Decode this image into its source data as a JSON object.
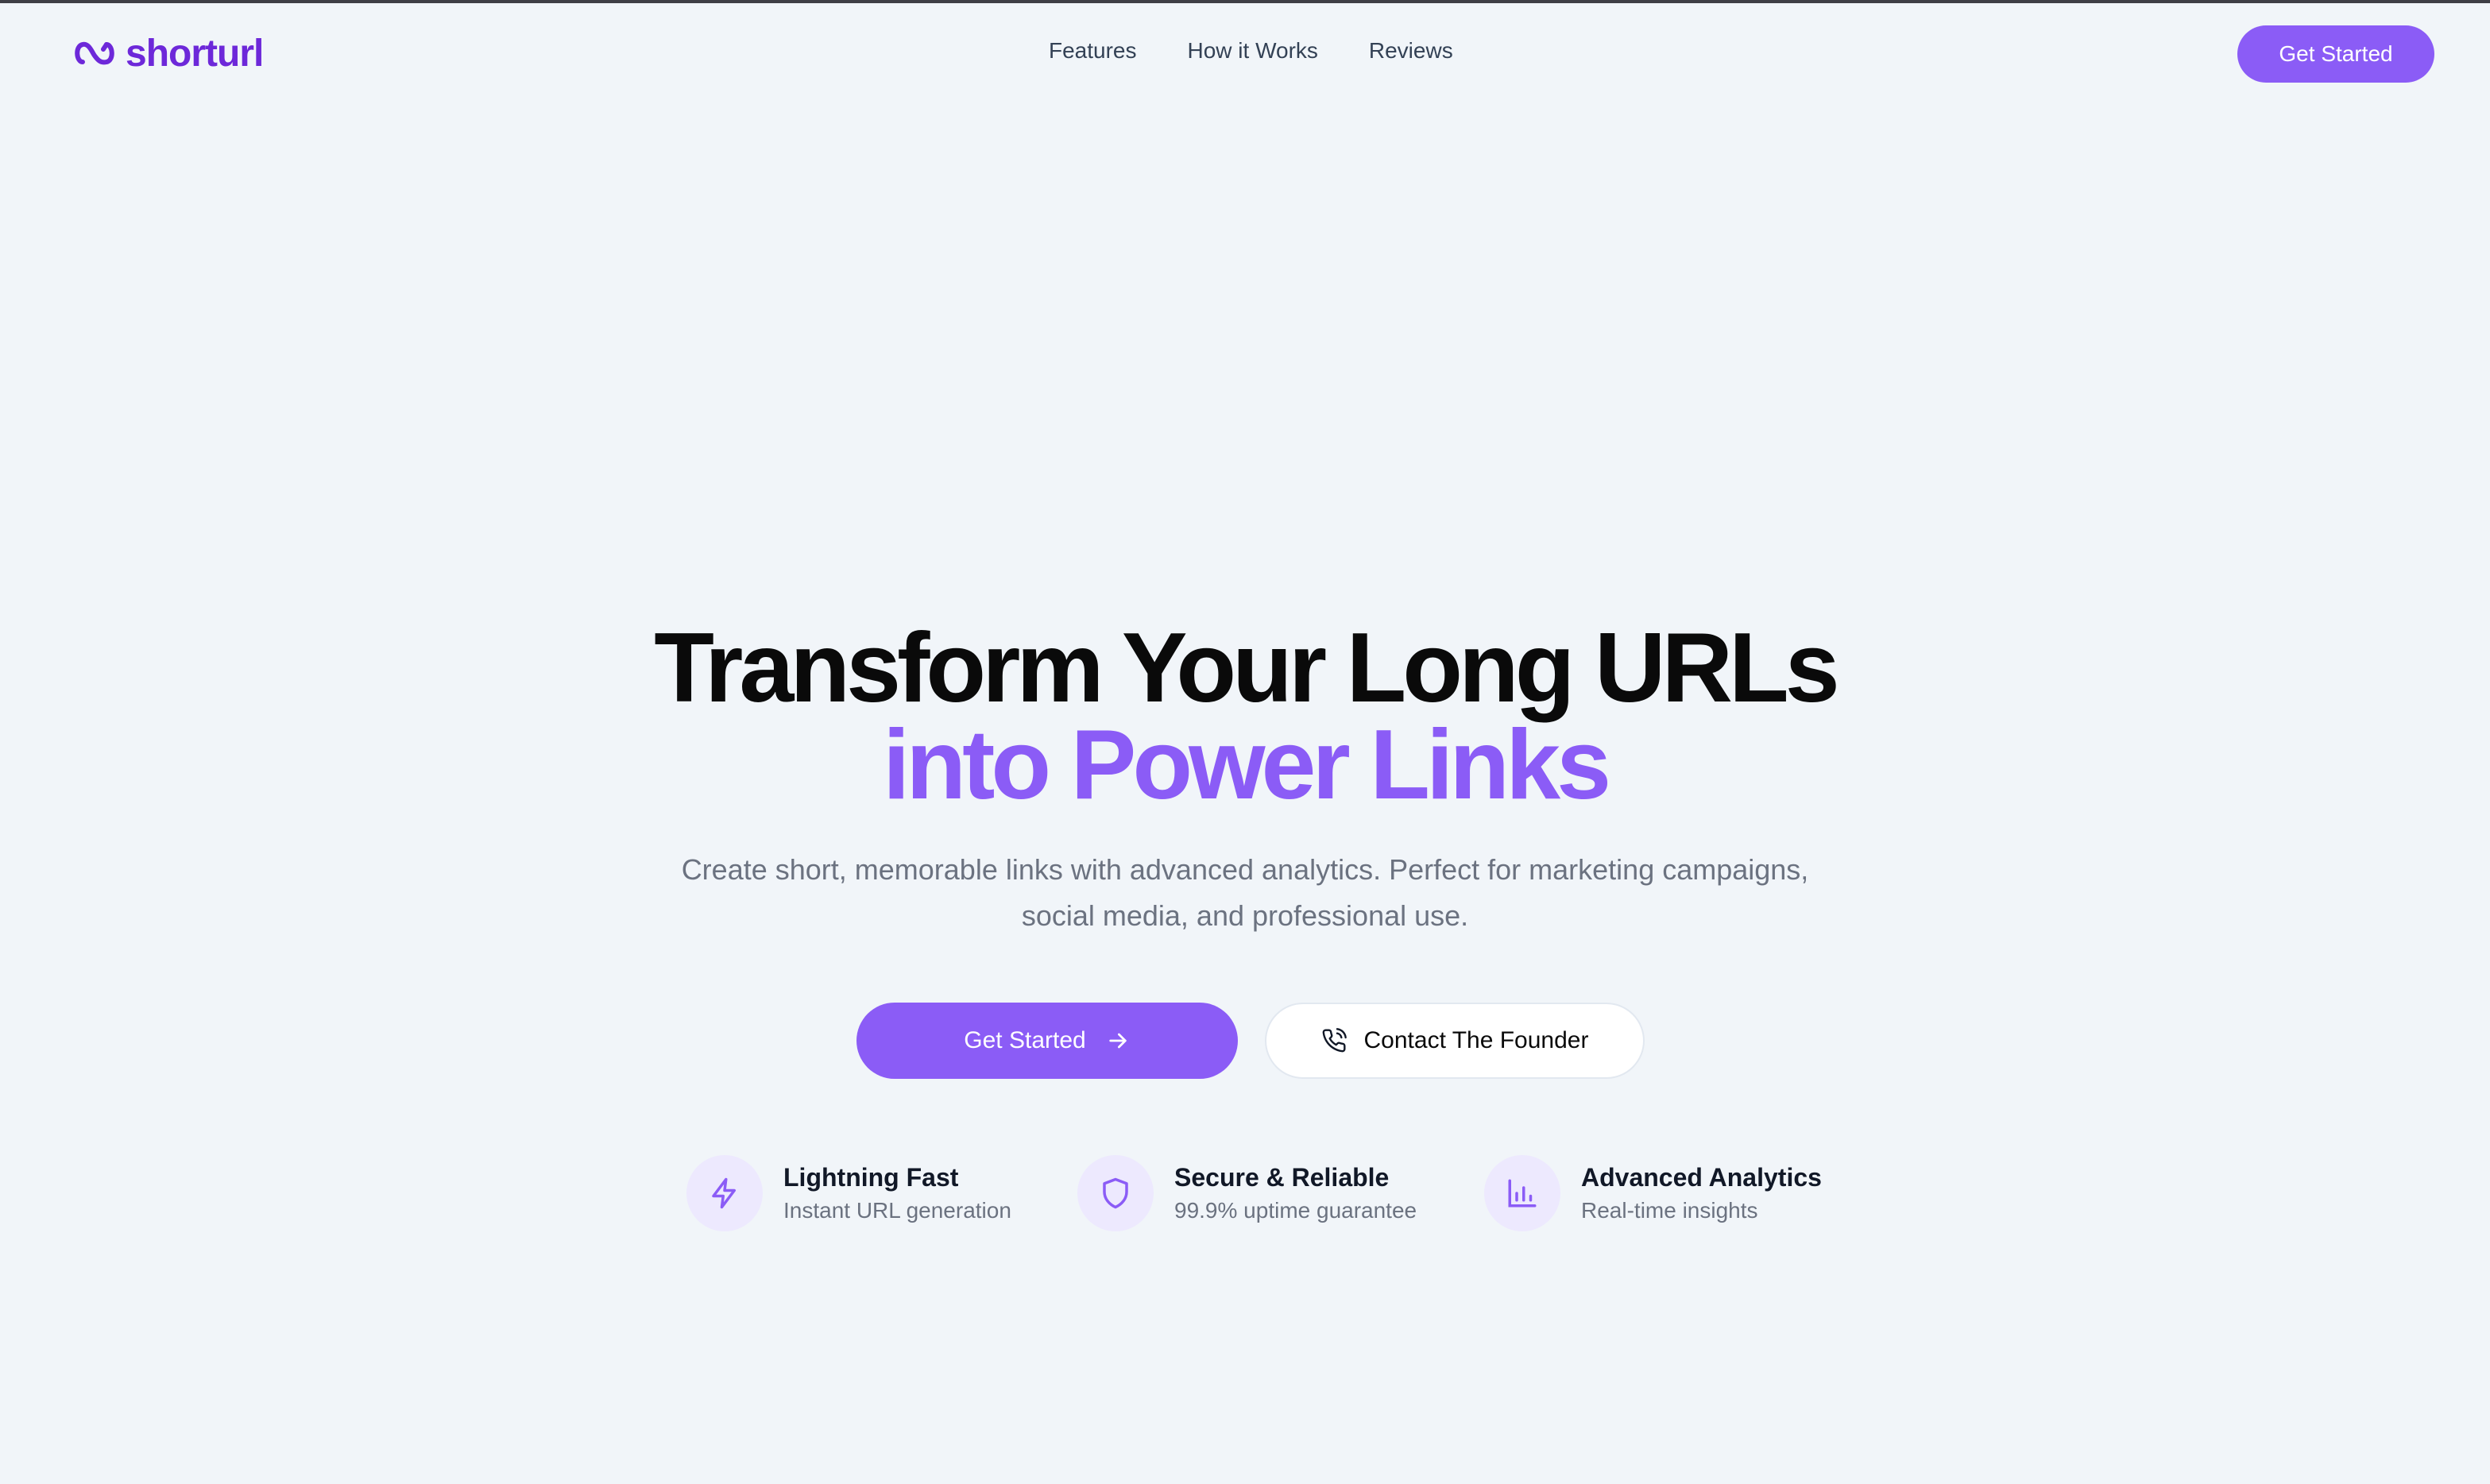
{
  "brand": {
    "name": "shorturl",
    "accent": "#8b5cf6",
    "logo_color": "#6d28d9",
    "logo_icon": "link-loop-icon"
  },
  "nav": {
    "items": [
      {
        "label": "Features"
      },
      {
        "label": "How it Works"
      },
      {
        "label": "Reviews"
      }
    ],
    "cta_label": "Get Started"
  },
  "hero": {
    "headline_line1": "Transform Your Long URLs",
    "headline_line2": "into Power Links",
    "subtitle": "Create short, memorable links with advanced analytics. Perfect for marketing campaigns, social media, and professional use.",
    "primary_cta": {
      "label": "Get Started",
      "icon": "arrow-right-icon"
    },
    "secondary_cta": {
      "label": "Contact The Founder",
      "icon": "phone-icon"
    }
  },
  "features": [
    {
      "title": "Lightning Fast",
      "description": "Instant URL generation",
      "icon": "lightning-icon"
    },
    {
      "title": "Secure & Reliable",
      "description": "99.9% uptime guarantee",
      "icon": "shield-icon"
    },
    {
      "title": "Advanced Analytics",
      "description": "Real-time insights",
      "icon": "bar-chart-icon"
    }
  ]
}
